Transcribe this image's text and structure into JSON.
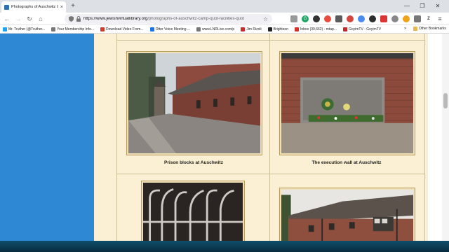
{
  "browser": {
    "tab": {
      "title": "Photographs of Auschwitz Ca...",
      "close": "×"
    },
    "new_tab": "+",
    "window": {
      "minimize": "—",
      "maximize": "❐",
      "close": "✕"
    },
    "nav": {
      "back": "←",
      "forward": "→",
      "reload": "↻",
      "home": "⌂"
    },
    "url": {
      "host": "https://www.jewishvirtuallibrary.org",
      "path": "/photographs-of-auschwitz-camp-quot-facilities-quot"
    },
    "bookmarks": [
      {
        "label": "Mr. Truther (@Truther...",
        "icon": "twitter-icon",
        "color": "#1da1f2"
      },
      {
        "label": "Your Membership Info...",
        "icon": "globe-icon",
        "color": "#777777"
      },
      {
        "label": "Download Video From...",
        "icon": "download-icon",
        "color": "#d23b2a"
      },
      {
        "label": "Otter Voice Meeting ...",
        "icon": "otter-icon",
        "color": "#1a73e8"
      },
      {
        "label": "www.LNRLive.com/p",
        "icon": "globe-icon",
        "color": "#777777"
      },
      {
        "label": "Jim Rizoli",
        "icon": "rizoli-icon",
        "color": "#cc2b2b"
      },
      {
        "label": "Brighteon",
        "icon": "brighteon-icon",
        "color": "#222222"
      },
      {
        "label": "Inbox (39,662) - mtap...",
        "icon": "gmail-icon",
        "color": "#d93025"
      },
      {
        "label": "GoyimTV - GoyimTV",
        "icon": "goyimtv-icon",
        "color": "#c62828"
      }
    ],
    "bookmarks_more": "»",
    "other_bookmarks": "Other Bookmarks"
  },
  "page": {
    "photos": [
      {
        "caption": "Prison blocks at Auschwitz",
        "image": "prison-blocks-photo"
      },
      {
        "caption": "The execution wall at Auschwitz",
        "image": "execution-wall-photo"
      },
      {
        "caption": "",
        "image": "iron-gate-photo"
      },
      {
        "caption": "",
        "image": "barracks-photo"
      }
    ]
  },
  "colors": {
    "sidebar": "#2f88d4",
    "content_bg": "#fbf0d3",
    "frame": "#b89c5f",
    "taskbar": "#0b3a52"
  }
}
